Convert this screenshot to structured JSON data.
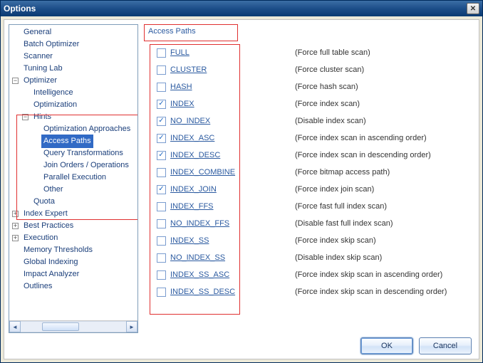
{
  "window": {
    "title": "Options"
  },
  "tree": {
    "items": [
      {
        "label": "General",
        "depth": 0,
        "expander": ""
      },
      {
        "label": "Batch Optimizer",
        "depth": 0,
        "expander": ""
      },
      {
        "label": "Scanner",
        "depth": 0,
        "expander": ""
      },
      {
        "label": "Tuning Lab",
        "depth": 0,
        "expander": ""
      },
      {
        "label": "Optimizer",
        "depth": 0,
        "expander": "minus"
      },
      {
        "label": "Intelligence",
        "depth": 1,
        "expander": ""
      },
      {
        "label": "Optimization",
        "depth": 1,
        "expander": ""
      },
      {
        "label": "Hints",
        "depth": 1,
        "expander": "minus"
      },
      {
        "label": "Optimization Approaches",
        "depth": 2,
        "expander": ""
      },
      {
        "label": "Access Paths",
        "depth": 2,
        "expander": "",
        "selected": true
      },
      {
        "label": "Query Transformations",
        "depth": 2,
        "expander": ""
      },
      {
        "label": "Join Orders / Operations",
        "depth": 2,
        "expander": ""
      },
      {
        "label": "Parallel Execution",
        "depth": 2,
        "expander": ""
      },
      {
        "label": "Other",
        "depth": 2,
        "expander": ""
      },
      {
        "label": "Quota",
        "depth": 1,
        "expander": ""
      },
      {
        "label": "Index Expert",
        "depth": 0,
        "expander": "plus"
      },
      {
        "label": "Best Practices",
        "depth": 0,
        "expander": "plus"
      },
      {
        "label": "Execution",
        "depth": 0,
        "expander": "plus"
      },
      {
        "label": "Memory Thresholds",
        "depth": 0,
        "expander": ""
      },
      {
        "label": "Global Indexing",
        "depth": 0,
        "expander": ""
      },
      {
        "label": "Impact Analyzer",
        "depth": 0,
        "expander": ""
      },
      {
        "label": "Outlines",
        "depth": 0,
        "expander": ""
      }
    ]
  },
  "panel": {
    "title": "Access Paths",
    "items": [
      {
        "name": "FULL",
        "desc": "(Force full table scan)",
        "checked": false
      },
      {
        "name": "CLUSTER",
        "desc": "(Force cluster scan)",
        "checked": false
      },
      {
        "name": "HASH",
        "desc": "(Force hash scan)",
        "checked": false
      },
      {
        "name": "INDEX",
        "desc": "(Force index scan)",
        "checked": true
      },
      {
        "name": "NO_INDEX",
        "desc": "(Disable index scan)",
        "checked": true
      },
      {
        "name": "INDEX_ASC",
        "desc": "(Force index scan in ascending order)",
        "checked": true
      },
      {
        "name": "INDEX_DESC",
        "desc": "(Force index scan in descending order)",
        "checked": true
      },
      {
        "name": "INDEX_COMBINE",
        "desc": "(Force bitmap access path)",
        "checked": false
      },
      {
        "name": "INDEX_JOIN",
        "desc": "(Force index join scan)",
        "checked": true
      },
      {
        "name": "INDEX_FFS",
        "desc": "(Force fast full index scan)",
        "checked": false
      },
      {
        "name": "NO_INDEX_FFS",
        "desc": "(Disable fast full index scan)",
        "checked": false
      },
      {
        "name": "INDEX_SS",
        "desc": "(Force index skip scan)",
        "checked": false
      },
      {
        "name": "NO_INDEX_SS",
        "desc": "(Disable index skip scan)",
        "checked": false
      },
      {
        "name": "INDEX_SS_ASC",
        "desc": "(Force index skip scan in ascending order)",
        "checked": false
      },
      {
        "name": "INDEX_SS_DESC",
        "desc": "(Force index skip scan in descending order)",
        "checked": false
      }
    ]
  },
  "buttons": {
    "ok": "OK",
    "cancel": "Cancel"
  }
}
